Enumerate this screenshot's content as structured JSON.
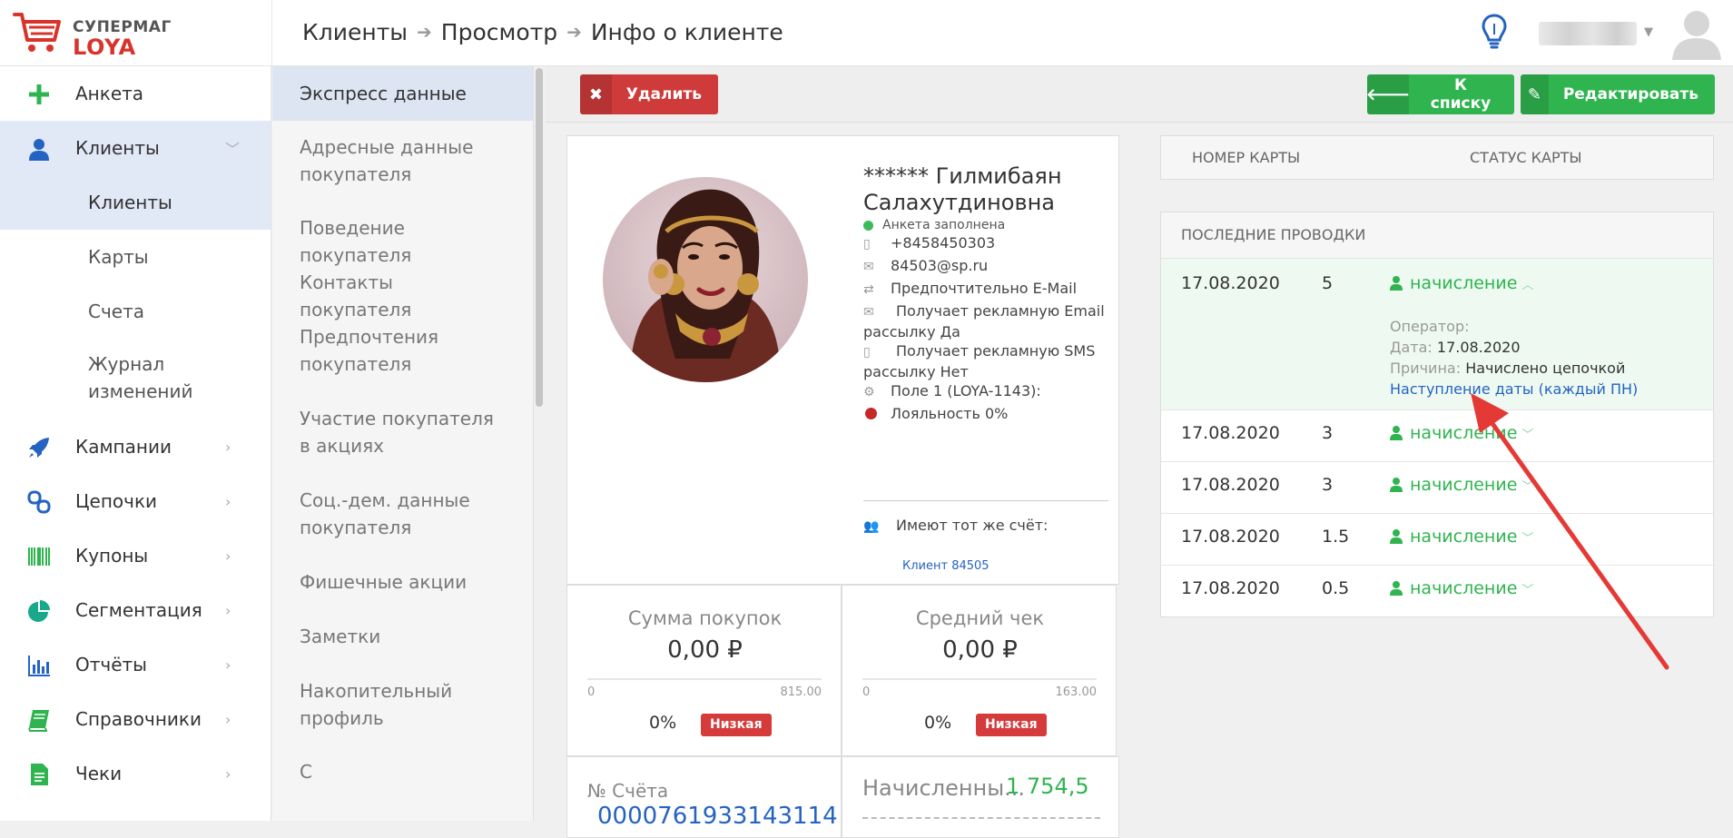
{
  "header": {
    "brand_top": "СУПЕРМАГ",
    "brand_bottom": "LOYA",
    "breadcrumb": [
      "Клиенты",
      "Просмотр",
      "Инфо о клиенте"
    ],
    "icons": {
      "logo": "shopping-cart-icon",
      "hint": "lightbulb-icon",
      "user": "user-avatar-icon"
    }
  },
  "sidebar": {
    "items": [
      {
        "label": "Анкета",
        "icon": "plus-icon",
        "color": "#2fb44f"
      },
      {
        "label": "Клиенты",
        "icon": "user-icon",
        "color": "#2563c2",
        "active": true
      },
      {
        "label": "Кампании",
        "icon": "rocket-icon",
        "color": "#2563c2"
      },
      {
        "label": "Цепочки",
        "icon": "chain-icon",
        "color": "#2563c2"
      },
      {
        "label": "Купоны",
        "icon": "barcode-icon",
        "color": "#2fb44f"
      },
      {
        "label": "Сегментация",
        "icon": "pie-chart-icon",
        "color": "#1aa88a"
      },
      {
        "label": "Отчёты",
        "icon": "bar-chart-icon",
        "color": "#2563c2"
      },
      {
        "label": "Справочники",
        "icon": "book-icon",
        "color": "#2fb44f"
      },
      {
        "label": "Чеки",
        "icon": "receipt-icon",
        "color": "#2fb44f"
      }
    ],
    "sub_items": [
      "Клиенты",
      "Карты",
      "Счета",
      "Журнал изменений"
    ]
  },
  "subnav": {
    "items": [
      "Экспресс данные",
      "Адресные данные покупателя",
      "Поведение покупателя",
      "Контакты покупателя",
      "Предпочтения покупателя",
      "Участие покупателя в акциях",
      "Соц.-дем. данные покупателя",
      "Фишечные акции",
      "Заметки",
      "Накопительный профиль",
      "С"
    ]
  },
  "toolbar": {
    "delete_label": "Удалить",
    "list_label": "К списку",
    "edit_label": "Редактировать",
    "colors": {
      "danger": "#cf3b3b",
      "success": "#2fb44f"
    }
  },
  "profile": {
    "name": "****** Гилмибаян Салахутдиновна",
    "status": "Анкета заполнена",
    "phone": "+8458450303",
    "email": "84503@sp.ru",
    "preference": "Предпочтительно E-Mail",
    "email_ads": "Получает рекламную Email рассылку Да",
    "sms_ads": "Получает рекламную SMS рассылку Нет",
    "field1": "Поле 1 (LOYA-1143):",
    "loyalty": "Лояльность 0%",
    "shared_title": "Имеют тот же счёт:",
    "shared_link": "Клиент 84505"
  },
  "stats": {
    "sum": {
      "title": "Сумма покупок",
      "value": "0,00 ₽",
      "min": "0",
      "max": "815.00",
      "pct": "0%",
      "badge": "Низкая"
    },
    "avg": {
      "title": "Средний чек",
      "value": "0,00 ₽",
      "min": "0",
      "max": "163.00",
      "pct": "0%",
      "badge": "Низкая"
    },
    "account": {
      "label": "№ Счёта",
      "value": "0000761933143114"
    },
    "accrued": {
      "label": "Начисленны...",
      "value": "1 754,5"
    }
  },
  "cards_table": {
    "col_number": "НОМЕР КАРТЫ",
    "col_status": "СТАТУС КАРТЫ"
  },
  "transactions": {
    "title": "ПОСЛЕДНИЕ ПРОВОДКИ",
    "rows": [
      {
        "date": "17.08.2020",
        "amount": "5",
        "type": "начисление"
      },
      {
        "date": "17.08.2020",
        "amount": "3",
        "type": "начисление"
      },
      {
        "date": "17.08.2020",
        "amount": "3",
        "type": "начисление"
      },
      {
        "date": "17.08.2020",
        "amount": "1.5",
        "type": "начисление"
      },
      {
        "date": "17.08.2020",
        "amount": "0.5",
        "type": "начисление"
      }
    ],
    "detail": {
      "operator_label": "Оператор:",
      "date_label": "Дата:",
      "date_value": "17.08.2020",
      "reason_label": "Причина:",
      "reason_value": "Начислено цепочкой",
      "reason_link": "Наступление даты (каждый ПН)"
    }
  }
}
